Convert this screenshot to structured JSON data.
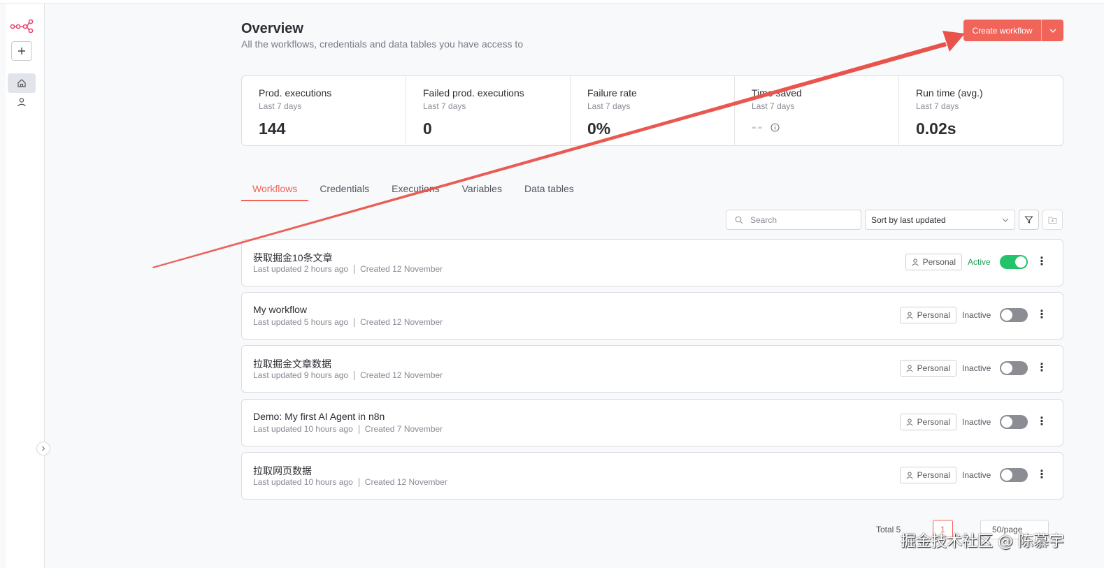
{
  "header": {
    "title": "Overview",
    "subtitle": "All the workflows, credentials and data tables you have access to",
    "create_button": "Create workflow"
  },
  "stats": [
    {
      "label": "Prod. executions",
      "period": "Last 7 days",
      "value": "144"
    },
    {
      "label": "Failed prod. executions",
      "period": "Last 7 days",
      "value": "0"
    },
    {
      "label": "Failure rate",
      "period": "Last 7 days",
      "value": "0%"
    },
    {
      "label": "Time saved",
      "period": "Last 7 days",
      "value": "--"
    },
    {
      "label": "Run time (avg.)",
      "period": "Last 7 days",
      "value": "0.02s"
    }
  ],
  "tabs": [
    "Workflows",
    "Credentials",
    "Executions",
    "Variables",
    "Data tables"
  ],
  "toolbar": {
    "search_placeholder": "Search",
    "sort_value": "Sort by last updated"
  },
  "workflows": [
    {
      "name": "获取掘金10条文章",
      "updated": "Last updated 2 hours ago",
      "created": "Created 12 November",
      "owner": "Personal",
      "status": "Active",
      "active": true
    },
    {
      "name": "My workflow",
      "updated": "Last updated 5 hours ago",
      "created": "Created 12 November",
      "owner": "Personal",
      "status": "Inactive",
      "active": false
    },
    {
      "name": "拉取掘金文章数据",
      "updated": "Last updated 9 hours ago",
      "created": "Created 12 November",
      "owner": "Personal",
      "status": "Inactive",
      "active": false
    },
    {
      "name": "Demo: My first AI Agent in n8n",
      "updated": "Last updated 10 hours ago",
      "created": "Created 7 November",
      "owner": "Personal",
      "status": "Inactive",
      "active": false
    },
    {
      "name": "拉取网页数据",
      "updated": "Last updated 10 hours ago",
      "created": "Created 12 November",
      "owner": "Personal",
      "status": "Inactive",
      "active": false
    }
  ],
  "pagination": {
    "total": "Total 5",
    "current_page": "1",
    "per_page": "50/page"
  },
  "watermark": "掘金技术社区 @ 陈慕宇",
  "colors": {
    "accent": "#f0645a",
    "active_green": "#23c36b",
    "annotation_arrow": "#e8524a"
  },
  "icons": [
    "n8n-logo-icon",
    "plus-icon",
    "home-icon",
    "user-icon",
    "chevron-right-icon",
    "chevron-down-icon",
    "info-icon",
    "search-icon",
    "filter-icon",
    "folder-plus-icon",
    "more-vertical-icon"
  ]
}
